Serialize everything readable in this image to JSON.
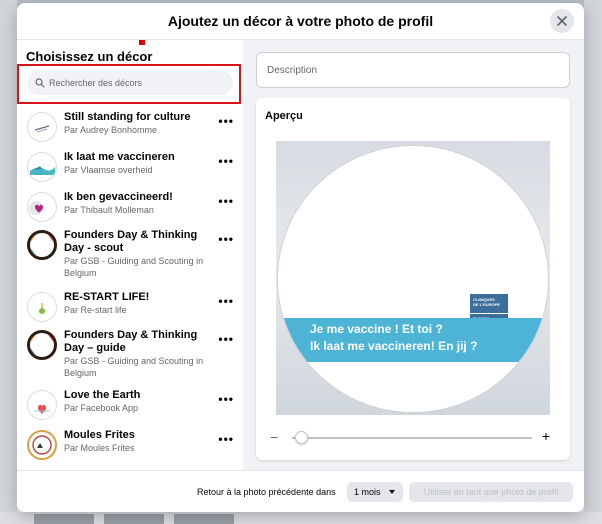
{
  "dialog": {
    "title": "Ajoutez un décor à votre photo de profil"
  },
  "left": {
    "title": "Choisissez un décor",
    "search_placeholder": "Rechercher des décors",
    "items": [
      {
        "title": "Still standing for culture",
        "sub": "Par Audrey Bonhomme",
        "icon": "still-standing-logo"
      },
      {
        "title": "Ik laat me vaccineren",
        "sub": "Par Vlaamse overheid",
        "icon": "vlaamse-overheid-logo"
      },
      {
        "title": "Ik ben gevaccineerd!",
        "sub": "Par Thibault Molleman",
        "icon": "vaccine-heart-logo"
      },
      {
        "title": "Founders Day & Thinking Day - scout",
        "sub": "Par GSB - Guiding and Scouting in Belgium",
        "icon": "scout-ring-logo"
      },
      {
        "title": "RE-START LIFE!",
        "sub": "Par Re-start life",
        "icon": "restart-life-logo"
      },
      {
        "title": "Founders Day & Thinking Day – guide",
        "sub": "Par GSB - Guiding and Scouting in Belgium",
        "icon": "guide-ring-logo"
      },
      {
        "title": "Love the Earth",
        "sub": "Par Facebook App",
        "icon": "love-earth-logo"
      },
      {
        "title": "Moules Frites",
        "sub": "Par Moules Frites",
        "icon": "moules-frites-logo"
      }
    ],
    "more_label": "•••"
  },
  "right": {
    "description_placeholder": "Description",
    "preview_label": "Aperçu",
    "banner_line1": "Je me vaccine ! Et toi ?",
    "banner_line2": "Ik laat me vaccineren! En jij ?",
    "logo_line1": "CLINIQUES",
    "logo_line2": "DE L'EUROPE",
    "logo_line3": "EUROPA",
    "logo_line4": "ZIEKENHUIZEN",
    "zoom_minus": "−",
    "zoom_plus": "+",
    "zoom_level": 0.04
  },
  "footer": {
    "return_text": "Retour à la photo précédente dans",
    "duration_value": "1 mois",
    "use_button": "Utiliser en tant que photo de profil"
  },
  "colors": {
    "accent_red": "#d7141a",
    "banner_blue": "#4db4d6"
  }
}
